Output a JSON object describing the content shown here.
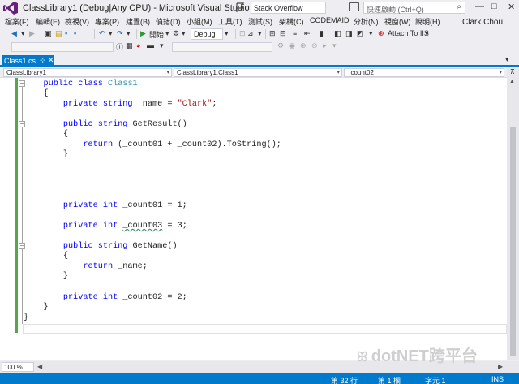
{
  "titlebar": {
    "title": "ClassLibrary1 (Debug|Any CPU) - Microsoft Visual Studio",
    "search_value": "Stack Overflow",
    "quick_launch": "快速啟動 (Ctrl+Q)",
    "minimize": "—",
    "restore": "□",
    "close": "✕"
  },
  "menu": {
    "items": [
      "檔案(F)",
      "編輯(E)",
      "檢視(V)",
      "專案(P)",
      "建置(B)",
      "偵錯(D)",
      "小組(M)",
      "工具(T)",
      "測試(S)",
      "架構(C)",
      "CODEMAID",
      "分析(N)",
      "視窗(W)",
      "說明(H)"
    ],
    "user": "Clark Chou"
  },
  "toolbar": {
    "start_label": "開始",
    "config": "Debug",
    "attach": "Attach To IIS"
  },
  "tab": {
    "filename": "Class1.cs",
    "pin": "⊹",
    "close": "✕"
  },
  "nav": {
    "project": "ClassLibrary1",
    "class": "ClassLibrary1.Class1",
    "member": "_count02"
  },
  "zoom": "100 %",
  "status": {
    "line": "第 32 行",
    "col": "第 1 欄",
    "char": "字元 1",
    "mode": "INS"
  },
  "watermark": "dotNET跨平台",
  "colors": {
    "accent": "#007acc",
    "keyword": "#0000ff",
    "type": "#2b91af",
    "string": "#a31515",
    "change_indicator": "#57a64a"
  }
}
